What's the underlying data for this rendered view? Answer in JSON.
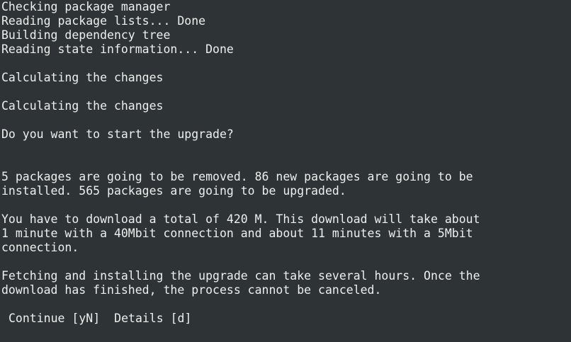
{
  "terminal": {
    "lines": [
      "Checking package manager",
      "Reading package lists... Done",
      "Building dependency tree",
      "Reading state information... Done",
      "",
      "Calculating the changes",
      "",
      "Calculating the changes",
      "",
      "Do you want to start the upgrade?",
      "",
      "",
      "5 packages are going to be removed. 86 new packages are going to be",
      "installed. 565 packages are going to be upgraded.",
      "",
      "You have to download a total of 420 M. This download will take about",
      "1 minute with a 40Mbit connection and about 11 minutes with a 5Mbit",
      "connection.",
      "",
      "Fetching and installing the upgrade can take several hours. Once the",
      "download has finished, the process cannot be canceled.",
      ""
    ],
    "prompt": {
      "continue_label": "Continue [yN]",
      "details_label": "Details [d]"
    }
  },
  "colors": {
    "background": "#2e3436",
    "foreground": "#eeeeec"
  }
}
